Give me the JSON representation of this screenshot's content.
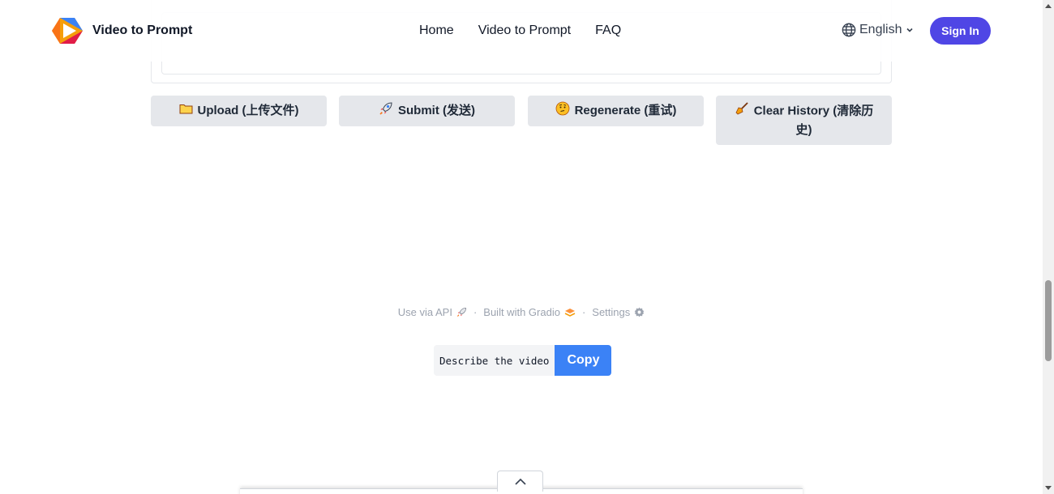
{
  "navbar": {
    "brand_name": "Video to Prompt",
    "links": [
      "Home",
      "Video to Prompt",
      "FAQ"
    ],
    "language": "English",
    "signin_label": "Sign In"
  },
  "actions": {
    "upload": "Upload (上传文件)",
    "submit": "Submit (发送)",
    "regenerate": "Regenerate (重试)",
    "clear": "Clear History (清除历史)"
  },
  "footer": {
    "api": "Use via API",
    "gradio": "Built with Gradio",
    "settings": "Settings",
    "separator": "·"
  },
  "prompt_widget": {
    "text": "Describe the video",
    "copy_label": "Copy"
  },
  "icons": {
    "upload": "folder-icon",
    "submit": "rocket-icon",
    "regenerate": "thinking-face-icon",
    "clear": "broom-icon",
    "language": "globe-icon",
    "api": "rocket-icon",
    "gradio": "gradio-logo-icon",
    "settings": "gear-icon"
  },
  "colors": {
    "signin_bg": "#4f46e5",
    "copy_bg": "#3b82f6",
    "button_bg": "#e5e7eb"
  }
}
